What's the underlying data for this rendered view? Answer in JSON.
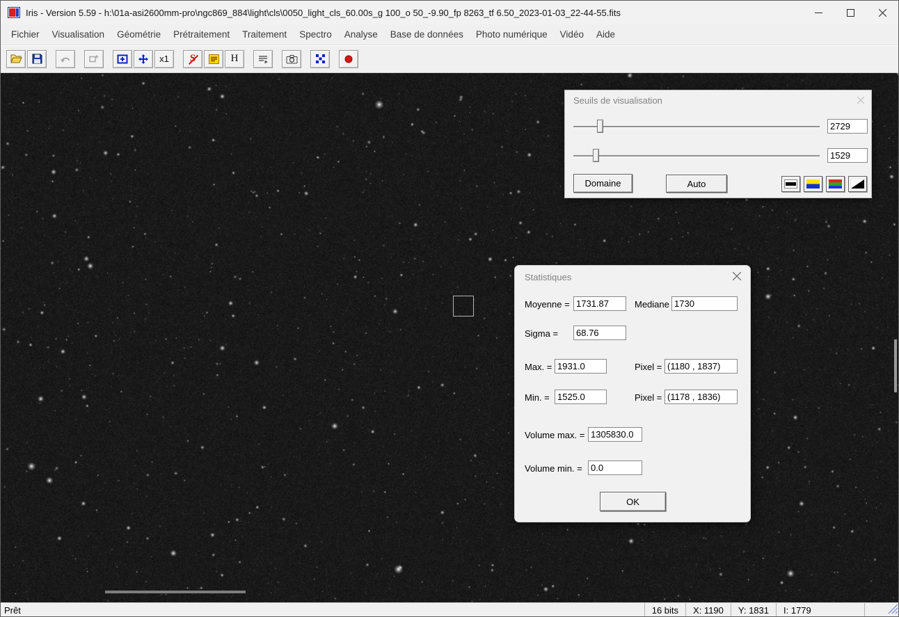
{
  "window": {
    "title": "Iris - Version 5.59 - h:\\01a-asi2600mm-pro\\ngc869_884\\light\\cls\\0050_light_cls_60.00s_g 100_o 50_-9.90_fp 8263_tf 6.50_2023-01-03_22-44-55.fits"
  },
  "menubar": {
    "items": [
      "Fichier",
      "Visualisation",
      "Géométrie",
      "Prétraitement",
      "Traitement",
      "Spectro",
      "Analyse",
      "Base de données",
      "Photo numérique",
      "Vidéo",
      "Aide"
    ]
  },
  "toolbar": {
    "x1_label": "x1",
    "h_label": "H",
    "s_label": "S"
  },
  "seuils": {
    "title": "Seuils de visualisation",
    "high_value": "2729",
    "low_value": "1529",
    "domaine_label": "Domaine",
    "auto_label": "Auto"
  },
  "stats": {
    "title": "Statistiques",
    "moyenne_label": "Moyenne =",
    "moyenne_value": "1731.87",
    "mediane_label": "Mediane =",
    "mediane_value": "1730",
    "sigma_label": "Sigma =",
    "sigma_value": "68.76",
    "max_label": "Max. =",
    "max_value": "1931.0",
    "max_pixel_label": "Pixel =",
    "max_pixel_value": "(1180 , 1837)",
    "min_label": "Min. =",
    "min_value": "1525.0",
    "min_pixel_label": "Pixel =",
    "min_pixel_value": "(1178 , 1836)",
    "volume_max_label": "Volume max. =",
    "volume_max_value": "1305830.0",
    "volume_min_label": "Volume min. =",
    "volume_min_value": "0.0",
    "ok_label": "OK"
  },
  "statusbar": {
    "ready": "Prêt",
    "bits": "16 bits",
    "x": "X: 1190",
    "y": "Y: 1831",
    "i": "I: 1779"
  },
  "colors": {
    "toolbar_blue": "#0a23c4",
    "toolbar_red": "#d91414",
    "threshold_yellow": "#ffd800"
  }
}
